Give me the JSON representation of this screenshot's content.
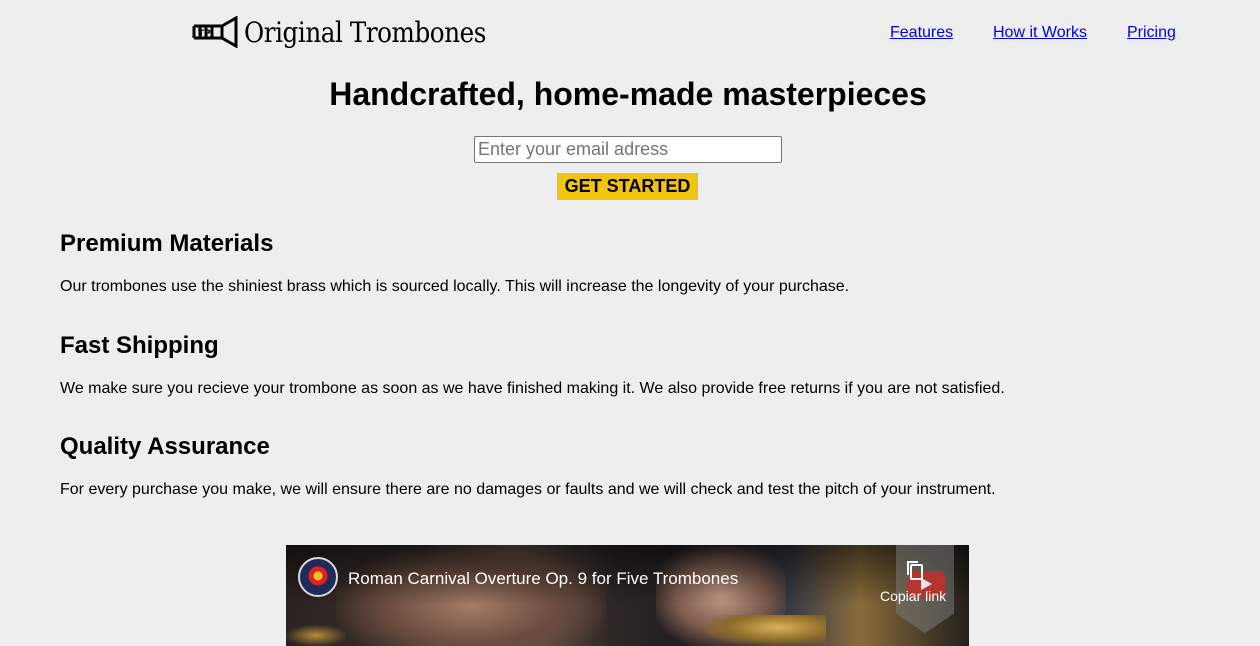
{
  "header": {
    "logo_text": "Original Trombones",
    "nav": [
      {
        "label": "Features"
      },
      {
        "label": "How it Works"
      },
      {
        "label": "Pricing"
      }
    ]
  },
  "hero": {
    "title": "Handcrafted, home-made masterpieces",
    "email_placeholder": "Enter your email adress",
    "email_value": "",
    "cta_label": "GET STARTED",
    "cta_color": "#f1c40f"
  },
  "features": [
    {
      "title": "Premium Materials",
      "text": "Our trombones use the shiniest brass which is sourced locally. This will increase the longevity of your purchase."
    },
    {
      "title": "Fast Shipping",
      "text": "We make sure you recieve your trombone as soon as we have finished making it. We also provide free returns if you are not satisfied."
    },
    {
      "title": "Quality Assurance",
      "text": "For every purchase you make, we will ensure there are no damages or faults and we will check and test the pitch of your instrument."
    }
  ],
  "video": {
    "title": "Roman Carnival Overture Op. 9 for Five Trombones",
    "copy_link_label": "Copiar link",
    "channel_icon": "channel-avatar",
    "play_icon": "youtube-play-icon",
    "copy_icon": "copy-icon"
  }
}
